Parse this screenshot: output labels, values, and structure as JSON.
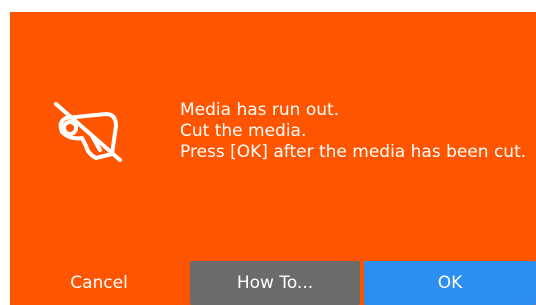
{
  "dialog": {
    "icon": "media-cut-icon",
    "message_lines": [
      "Media has run out.",
      "Cut the media.",
      "Press [OK] after the media has been cut."
    ],
    "colors": {
      "background": "#ff5500",
      "howto_button": "#6b6b6b",
      "ok_button": "#2b8ef0",
      "text": "#ffffff"
    }
  },
  "buttons": {
    "cancel": "Cancel",
    "howto": "How To...",
    "ok": "OK"
  }
}
